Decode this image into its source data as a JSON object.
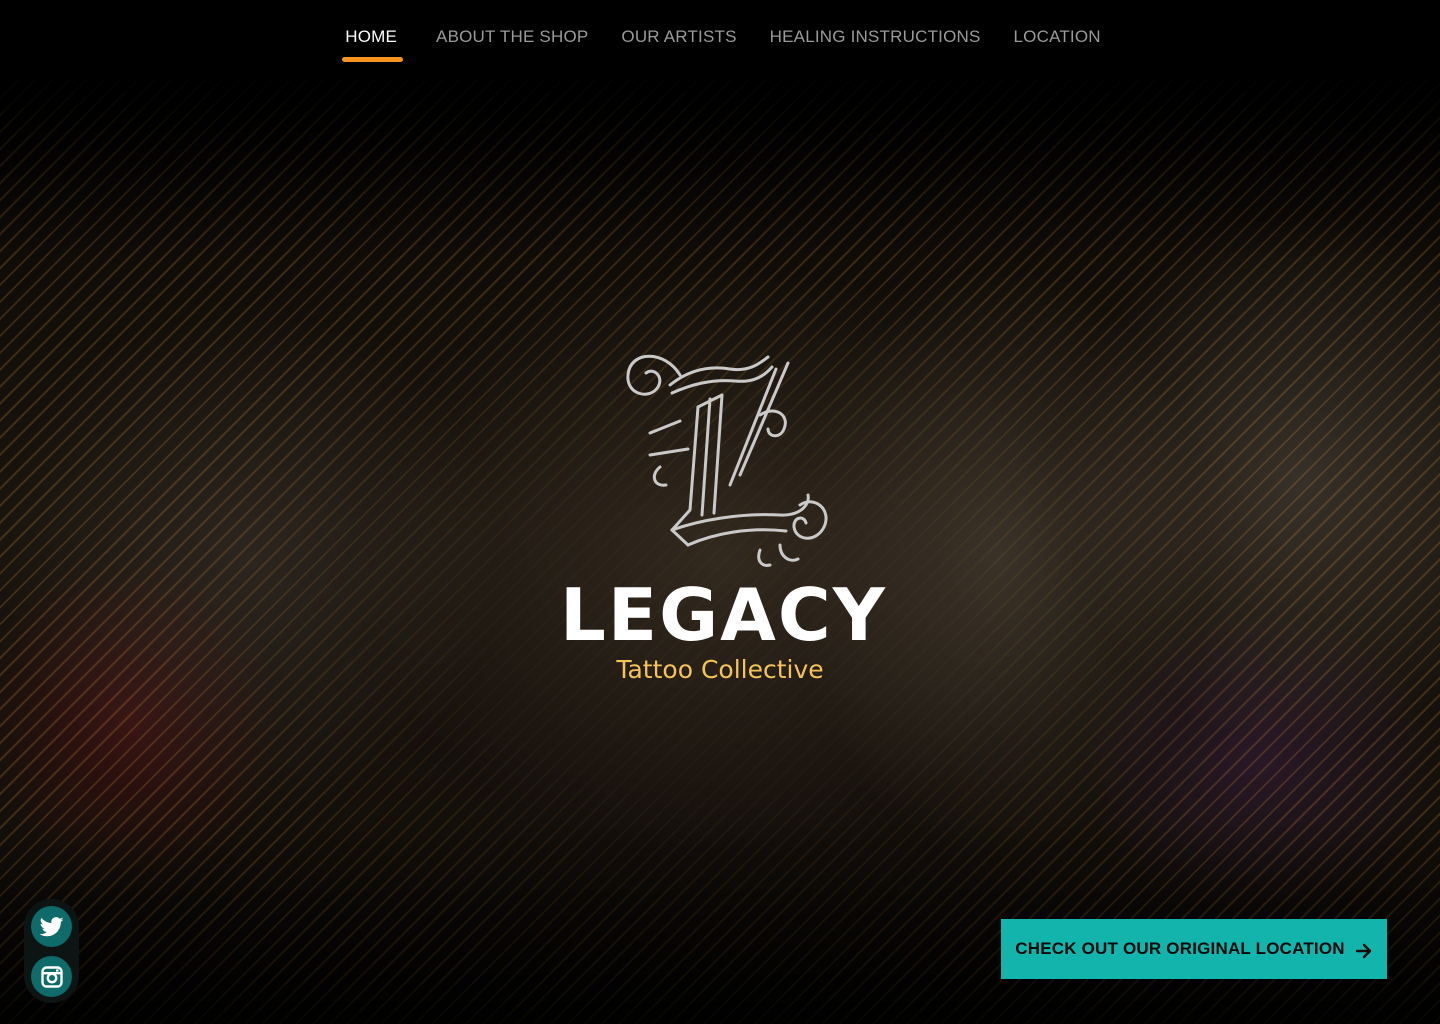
{
  "nav": {
    "items": [
      {
        "label": "HOME",
        "active": true
      },
      {
        "label": "ABOUT THE SHOP",
        "active": false
      },
      {
        "label": "OUR ARTISTS",
        "active": false
      },
      {
        "label": "HEALING INSTRUCTIONS",
        "active": false
      },
      {
        "label": "LOCATION",
        "active": false
      }
    ]
  },
  "hero": {
    "logo_letter": "L",
    "brand_name": "LEGACY",
    "tagline": "Tattoo Collective"
  },
  "social": {
    "items": [
      {
        "icon": "twitter-icon"
      },
      {
        "icon": "instagram-icon"
      }
    ]
  },
  "cta": {
    "label": "CHECK OUT OUR ORIGINAL LOCATION",
    "icon": "arrow-right-icon"
  },
  "colors": {
    "accent": "#f7941d",
    "teal": "#12b4ab",
    "tagline": "#f4c35a",
    "social_bg": "#0f6a6a"
  }
}
